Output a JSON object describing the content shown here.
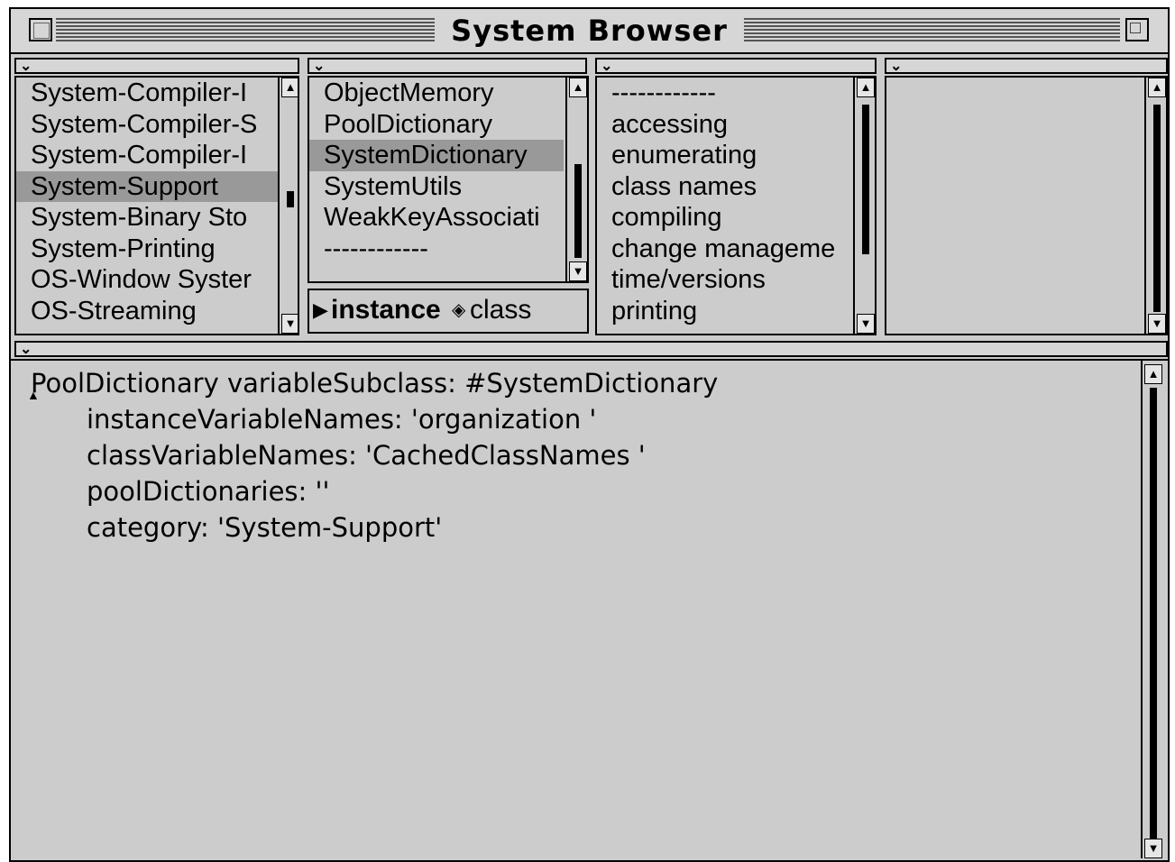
{
  "window": {
    "title": "System Browser"
  },
  "categories": {
    "items": [
      "System-Compiler-I",
      "System-Compiler-S",
      "System-Compiler-I",
      "System-Support",
      "System-Binary Sto",
      "System-Printing",
      "OS-Window Syster",
      "OS-Streaming"
    ],
    "selected_index": 3
  },
  "classes": {
    "items": [
      "ObjectMemory",
      "PoolDictionary",
      "SystemDictionary",
      "SystemUtils",
      "WeakKeyAssociati",
      "------------"
    ],
    "selected_index": 2
  },
  "mode_toggle": {
    "instance_label": "instance",
    "class_label": "class"
  },
  "protocols": {
    "items": [
      "------------",
      "accessing",
      "enumerating",
      "class names",
      "compiling",
      "change manageme",
      "time/versions",
      "printing"
    ]
  },
  "methods": {
    "items": []
  },
  "code": {
    "lines": [
      "PoolDictionary variableSubclass: #SystemDictionary",
      "instanceVariableNames: 'organization '",
      "classVariableNames: 'CachedClassNames '",
      "poolDictionaries: ''",
      "category: 'System-Support'"
    ]
  }
}
